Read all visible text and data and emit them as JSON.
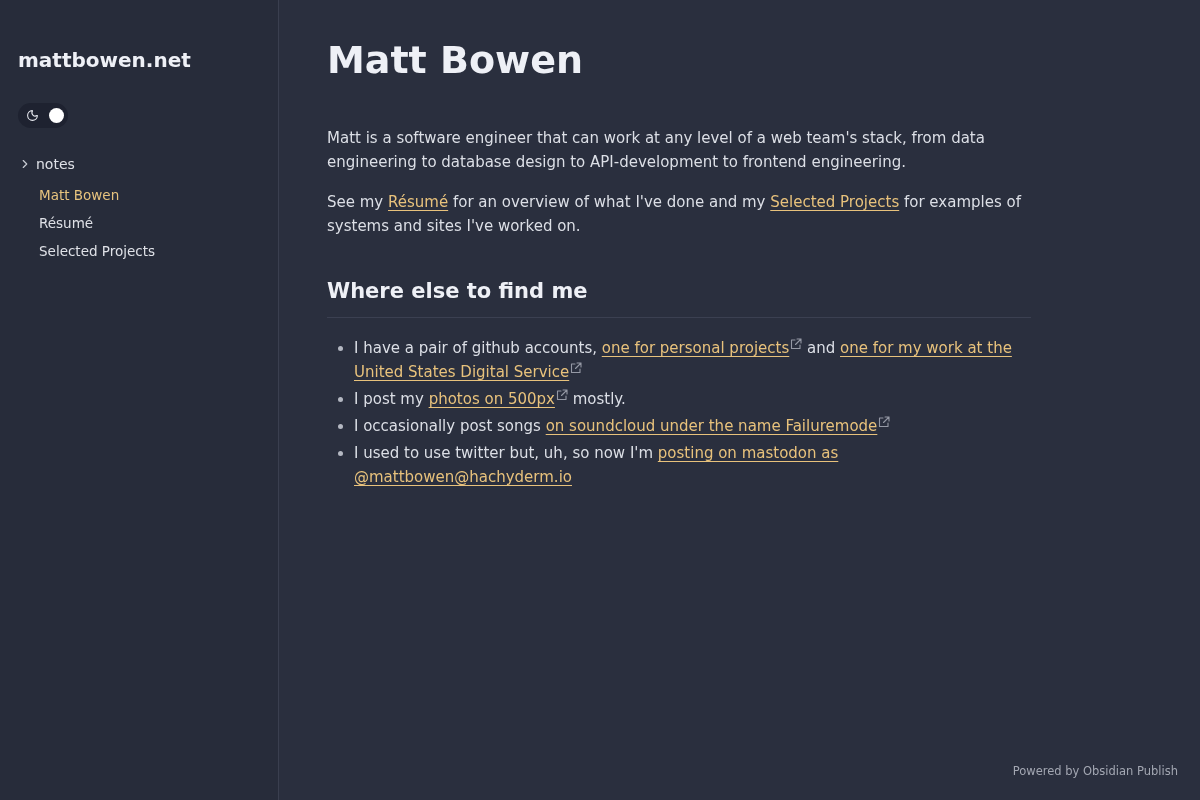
{
  "sidebar": {
    "site_name": "mattbowen.net",
    "theme_toggle": {
      "on": true
    },
    "tree": [
      {
        "label": "notes",
        "children": [
          {
            "label": "Matt Bowen",
            "selected": true
          },
          {
            "label": "Résumé",
            "selected": false
          },
          {
            "label": "Selected Projects",
            "selected": false
          }
        ]
      }
    ]
  },
  "page": {
    "title": "Matt Bowen",
    "paragraphs": [
      {
        "segments": [
          {
            "kind": "text",
            "text": "Matt is a software engineer that can work at any level of a web team's stack, from data engineering to database design to API-development to frontend engineering."
          }
        ]
      },
      {
        "segments": [
          {
            "kind": "text",
            "text": "See my "
          },
          {
            "kind": "link",
            "lines": [
              "Résumé"
            ],
            "external": false
          },
          {
            "kind": "text",
            "text": " for an overview of what I've done and my "
          },
          {
            "kind": "link",
            "lines": [
              "Selected Projects"
            ],
            "external": false
          },
          {
            "kind": "text",
            "text": " for examples of systems and sites I've worked on."
          }
        ]
      }
    ],
    "sections": [
      {
        "heading": "Where else to find me",
        "items": [
          {
            "segments": [
              {
                "kind": "text",
                "text": "I have a pair of github accounts, "
              },
              {
                "kind": "link",
                "lines": [
                  "one for personal projects"
                ],
                "external": true
              },
              {
                "kind": "text",
                "text": " and "
              },
              {
                "kind": "link",
                "lines": [
                  "one for my work at the",
                  "United States Digital Service"
                ],
                "external": true
              }
            ]
          },
          {
            "segments": [
              {
                "kind": "text",
                "text": "I post my "
              },
              {
                "kind": "link",
                "lines": [
                  "photos on 500px"
                ],
                "external": true
              },
              {
                "kind": "text",
                "text": " mostly."
              }
            ]
          },
          {
            "segments": [
              {
                "kind": "text",
                "text": "I occasionally post songs "
              },
              {
                "kind": "link",
                "lines": [
                  "on soundcloud under the name Failuremode"
                ],
                "external": true
              }
            ]
          },
          {
            "segments": [
              {
                "kind": "text",
                "text": "I used to use twitter but, uh, so now I'm "
              },
              {
                "kind": "link",
                "lines": [
                  "posting on mastodon as",
                  "@mattbowen@hachyderm.io"
                ],
                "external": false
              }
            ]
          }
        ]
      }
    ]
  },
  "footer": {
    "credit": "Powered by Obsidian Publish"
  }
}
